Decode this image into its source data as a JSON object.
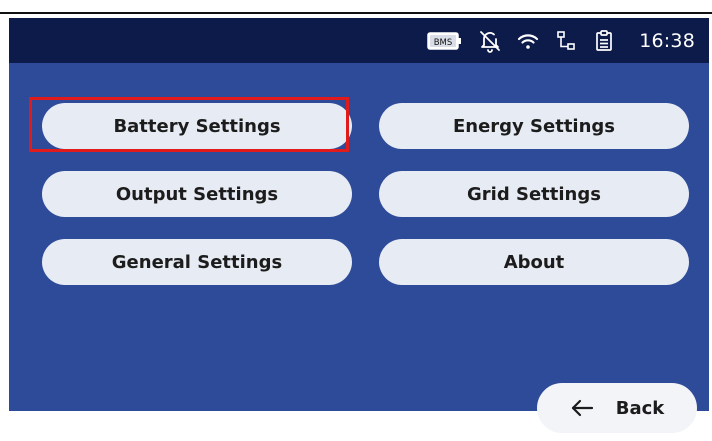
{
  "status_bar": {
    "bms_label": "BMS",
    "time": "16:38",
    "icons": [
      "bms-battery-icon",
      "bell-off-icon",
      "wifi-icon",
      "network-icon",
      "clipboard-icon"
    ]
  },
  "menu": {
    "battery_settings": "Battery Settings",
    "energy_settings": "Energy Settings",
    "output_settings": "Output Settings",
    "grid_settings": "Grid Settings",
    "general_settings": "General Settings",
    "about": "About"
  },
  "back": {
    "label": "Back"
  },
  "colors": {
    "status_bar": "#0d1b4a",
    "screen": "#2e4b99",
    "button": "#e7ebf3",
    "highlight": "#e11b1b"
  }
}
